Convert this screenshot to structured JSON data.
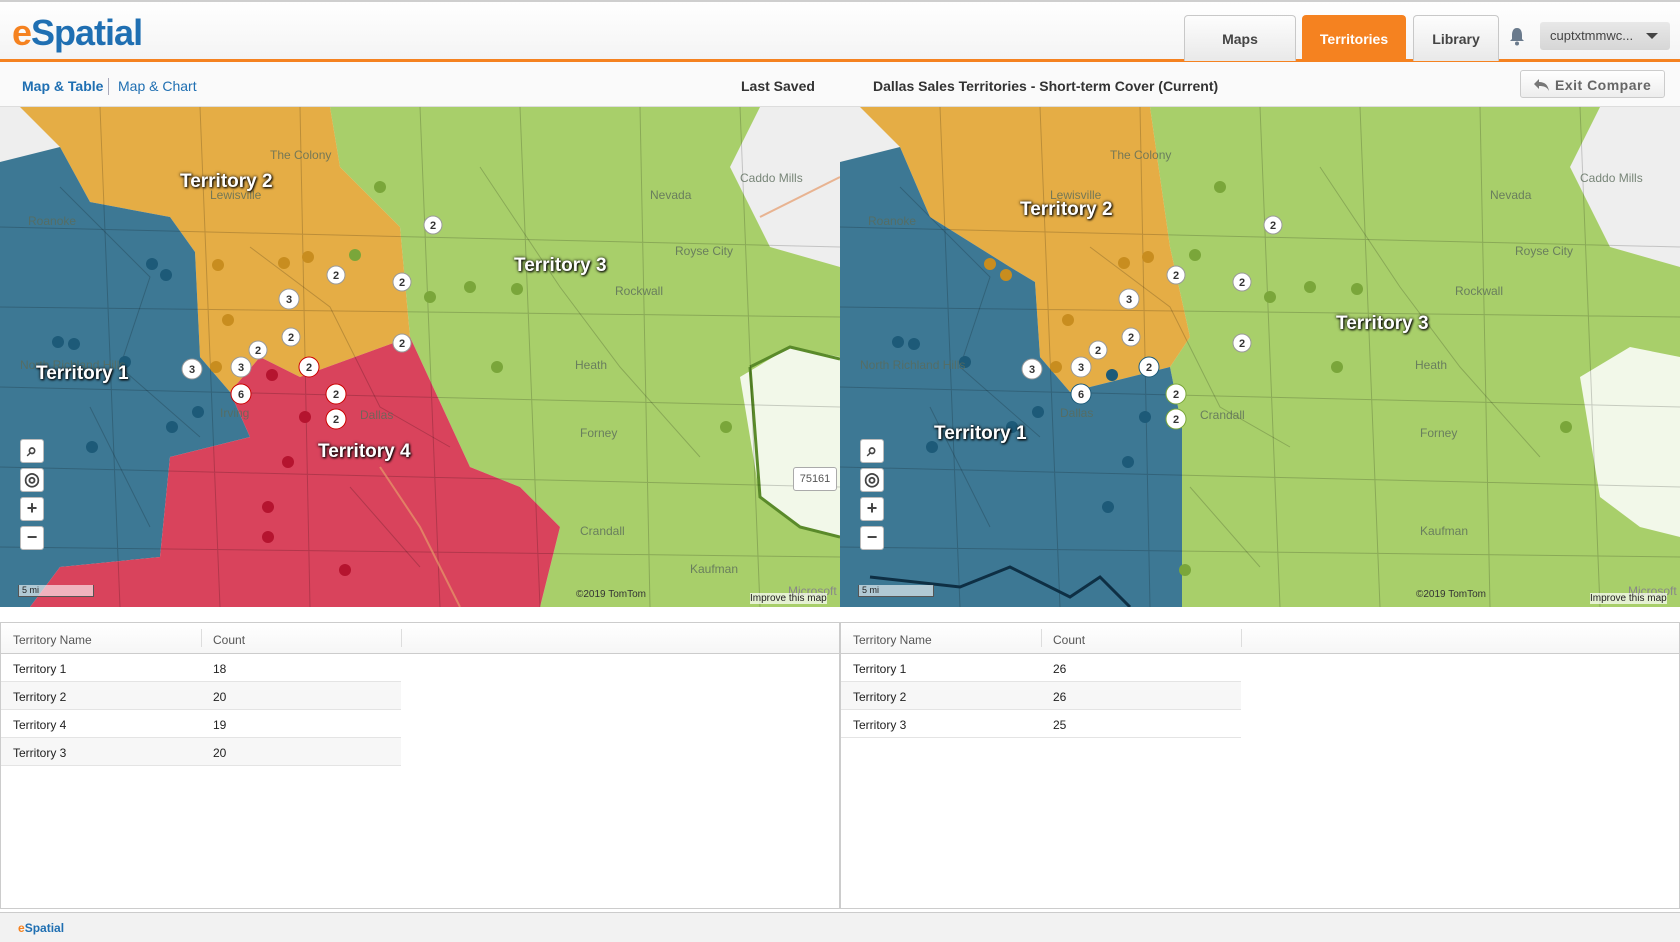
{
  "header": {
    "logo_e": "e",
    "logo_rest": "Spatial",
    "tabs": [
      "Maps",
      "Territories",
      "Library"
    ],
    "active_tab": "Territories",
    "user": "cuptxtmmwc..."
  },
  "subbar": {
    "view_map_table": "Map & Table",
    "view_map_chart": "Map & Chart",
    "last_saved": "Last Saved",
    "map_name": "Dallas Sales Territories - Short-term Cover (Current)",
    "exit_compare": "Exit Compare"
  },
  "colors": {
    "territory_1": "#3d7894",
    "territory_2": "#e5ad45",
    "territory_3": "#a8cf6a",
    "territory_4": "#d9435c",
    "accent": "#f58220",
    "brand_blue": "#1f6fb2"
  },
  "left_map": {
    "labels": [
      "Territory 1",
      "Territory 2",
      "Territory 3",
      "Territory 4"
    ],
    "places": [
      "The Colony",
      "Lewisville",
      "Caddo Mills",
      "Nevada",
      "Roanoke",
      "Royse City",
      "Rockwall",
      "North Richland Hills",
      "Heath",
      "Forney",
      "Irving",
      "Dallas",
      "Crandall",
      "Kaufman"
    ],
    "zip": "75161",
    "scale": "5 mi",
    "credit": "©2019 TomTom",
    "improve": "Improve this map",
    "ms": "Microsoft"
  },
  "right_map": {
    "labels": [
      "Territory 1",
      "Territory 2",
      "Territory 3"
    ],
    "places": [
      "The Colony",
      "Lewisville",
      "Caddo Mills",
      "Nevada",
      "Roanoke",
      "Royse City",
      "Rockwall",
      "North Richland Hills",
      "Heath",
      "Forney",
      "Dallas",
      "Crandall",
      "Kaufman"
    ],
    "scale": "5 mi",
    "credit": "©2019 TomTom",
    "improve": "Improve this map",
    "ms": "Microsoft"
  },
  "left_table": {
    "columns": [
      "Territory Name",
      "Count"
    ],
    "rows": [
      [
        "Territory 1",
        "18"
      ],
      [
        "Territory 2",
        "20"
      ],
      [
        "Territory 4",
        "19"
      ],
      [
        "Territory 3",
        "20"
      ]
    ]
  },
  "right_table": {
    "columns": [
      "Territory Name",
      "Count"
    ],
    "rows": [
      [
        "Territory 1",
        "26"
      ],
      [
        "Territory 2",
        "26"
      ],
      [
        "Territory 3",
        "25"
      ]
    ]
  },
  "footer": {
    "logo_e": "e",
    "logo_rest": "Spatial"
  }
}
